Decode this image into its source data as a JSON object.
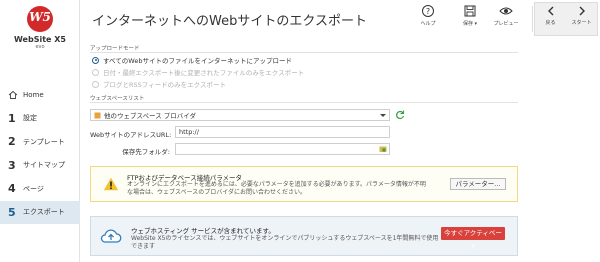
{
  "app": {
    "logo_mark": "W5",
    "name": "WebSite X5",
    "edition": "evo"
  },
  "sidebar": {
    "items": [
      {
        "num": "",
        "label": "Home",
        "icon": "home-icon"
      },
      {
        "num": "1",
        "label": "設定"
      },
      {
        "num": "2",
        "label": "テンプレート"
      },
      {
        "num": "3",
        "label": "サイトマップ"
      },
      {
        "num": "4",
        "label": "ページ"
      },
      {
        "num": "5",
        "label": "エクスポート"
      }
    ],
    "active_index": 5
  },
  "header": {
    "title": "インターネットへのWebサイトのエクスポート",
    "tools": [
      {
        "label": "ヘルプ",
        "icon": "help-icon"
      },
      {
        "label": "保存 ▾",
        "icon": "save-icon"
      },
      {
        "label": "プレビュー",
        "icon": "preview-icon"
      }
    ],
    "nav": {
      "back_label": "戻る",
      "next_label": "スタート"
    }
  },
  "upload_mode": {
    "section_label": "アップロードモード",
    "options": [
      {
        "label": "すべてのWebサイトのファイルをインターネットにアップロード",
        "checked": true,
        "disabled": false
      },
      {
        "label": "日付・最終エクスポート後に変更されたファイルのみをエクスポート",
        "checked": false,
        "disabled": true
      },
      {
        "label": "ブログとRSSフィードのみをエクスポート",
        "checked": false,
        "disabled": true
      }
    ]
  },
  "webspace": {
    "section_label": "ウェブスペースリスト",
    "selected": "他のウェブスペース プロバイダ",
    "url_label": "WebサイトのアドレスURL:",
    "url_value": "http://",
    "folder_label": "保存先フォルダ:",
    "folder_value": ""
  },
  "ftp_warning": {
    "title": "FTPおよびデータベース接続パラメータ",
    "description": "オンラインにエクスポートを進めるには、必要なパラメータを追加する必要があります。パラメータ情報が不明な場合は、ウェブスペースのプロバイダにお問い合わせください。",
    "button_label": "パラメーター..."
  },
  "hosting": {
    "title": "ウェブホスティング サービスが含まれています。",
    "description": "WebSite X5のライセンスでは、ウェブサイトをオンラインでパブリッシュするウェブスペースを1年間無料で使用できます",
    "button_label": "今すぐアクティベート"
  },
  "colors": {
    "accent": "#1f5f8e",
    "active_bg": "#dde8f1",
    "logo_red": "#d22a2a",
    "warn_border": "#f0d889",
    "activate_red": "#d9413d"
  }
}
